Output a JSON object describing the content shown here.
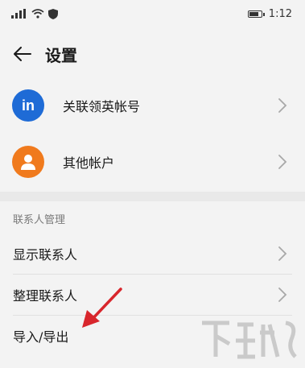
{
  "status": {
    "time": "1:12"
  },
  "header": {
    "title": "设置"
  },
  "accounts": [
    {
      "label": "关联领英帐号",
      "avatar_text": "in",
      "icon": "linkedin-icon",
      "color": "#1e6bd6"
    },
    {
      "label": "其他帐户",
      "icon": "person-icon",
      "color": "#f07a1d"
    }
  ],
  "contacts_section": {
    "title": "联系人管理",
    "items": [
      {
        "label": "显示联系人",
        "chevron": true
      },
      {
        "label": "整理联系人",
        "chevron": true
      },
      {
        "label": "导入/导出",
        "chevron": false
      }
    ]
  },
  "annotation": {
    "color": "#d8262c"
  }
}
